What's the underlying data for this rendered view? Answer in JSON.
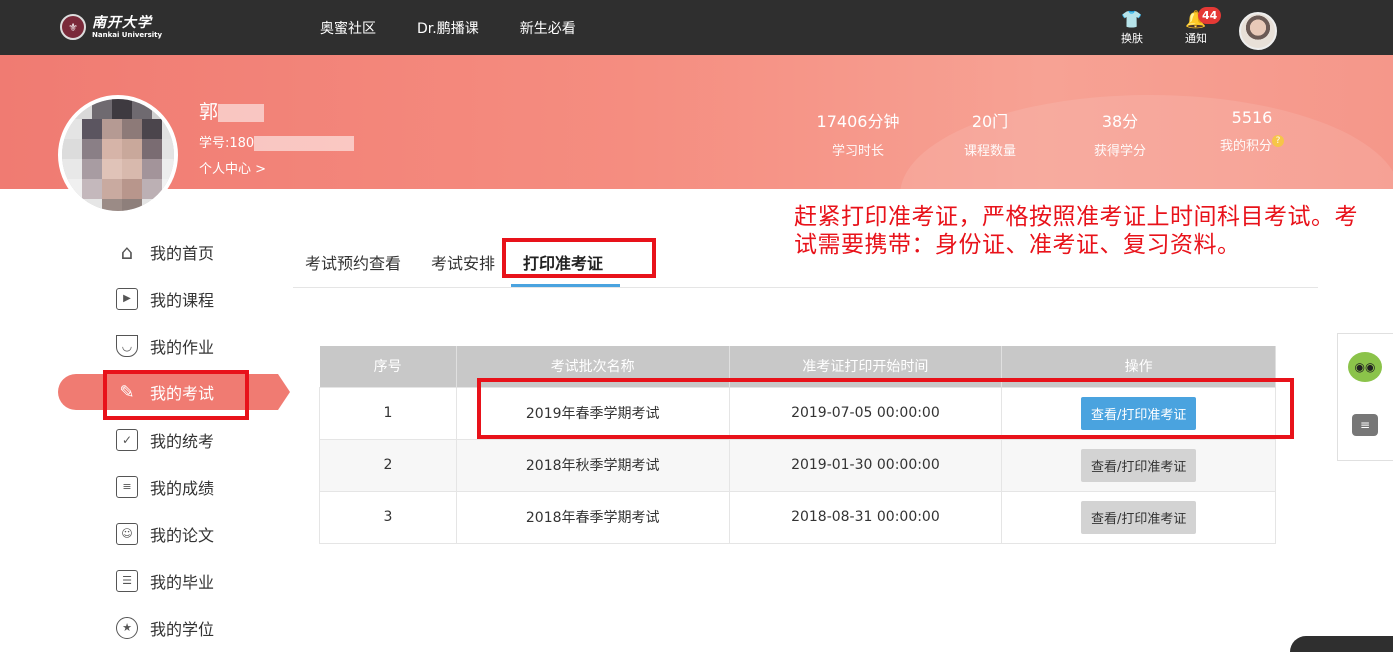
{
  "topbar": {
    "logo_cn": "南开大学",
    "logo_en": "Nankai University",
    "nav": [
      "奥蜜社区",
      "Dr.鹏播课",
      "新生必看"
    ],
    "skin_label": "换肤",
    "notify_label": "通知",
    "notify_count": "44"
  },
  "profile": {
    "name": "郭",
    "student_id": "学号:180",
    "center_link": "个人中心 >",
    "stats": [
      {
        "value": "17406分钟",
        "label": "学习时长"
      },
      {
        "value": "20门",
        "label": "课程数量"
      },
      {
        "value": "38分",
        "label": "获得学分"
      },
      {
        "value": "5516",
        "label": "我的积分"
      }
    ]
  },
  "sidebar": {
    "items": [
      {
        "label": "我的首页",
        "icon": "home-icon"
      },
      {
        "label": "我的课程",
        "icon": "course-icon"
      },
      {
        "label": "我的作业",
        "icon": "homework-icon"
      },
      {
        "label": "我的考试",
        "icon": "exam-icon",
        "active": true
      },
      {
        "label": "我的统考",
        "icon": "unified-exam-icon"
      },
      {
        "label": "我的成绩",
        "icon": "grades-icon"
      },
      {
        "label": "我的论文",
        "icon": "thesis-icon"
      },
      {
        "label": "我的毕业",
        "icon": "graduation-icon"
      },
      {
        "label": "我的学位",
        "icon": "degree-icon"
      }
    ]
  },
  "tabs": [
    "考试预约查看",
    "考试安排",
    "打印准考证"
  ],
  "annotation": "赶紧打印准考证，严格按照准考证上时间科目考试。考试需要携带：身份证、准考证、复习资料。",
  "table": {
    "headers": [
      "序号",
      "考试批次名称",
      "准考证打印开始时间",
      "操作"
    ],
    "rows": [
      {
        "no": "1",
        "name": "2019年春季学期考试",
        "time": "2019-07-05 00:00:00",
        "action": "查看/打印准考证"
      },
      {
        "no": "2",
        "name": "2018年秋季学期考试",
        "time": "2019-01-30 00:00:00",
        "action": "查看/打印准考证"
      },
      {
        "no": "3",
        "name": "2018年春季学期考试",
        "time": "2018-08-31 00:00:00",
        "action": "查看/打印准考证"
      }
    ]
  },
  "colors": {
    "banner": "#f07b72",
    "accent": "#4aa3df",
    "annotation": "#e8121a"
  }
}
